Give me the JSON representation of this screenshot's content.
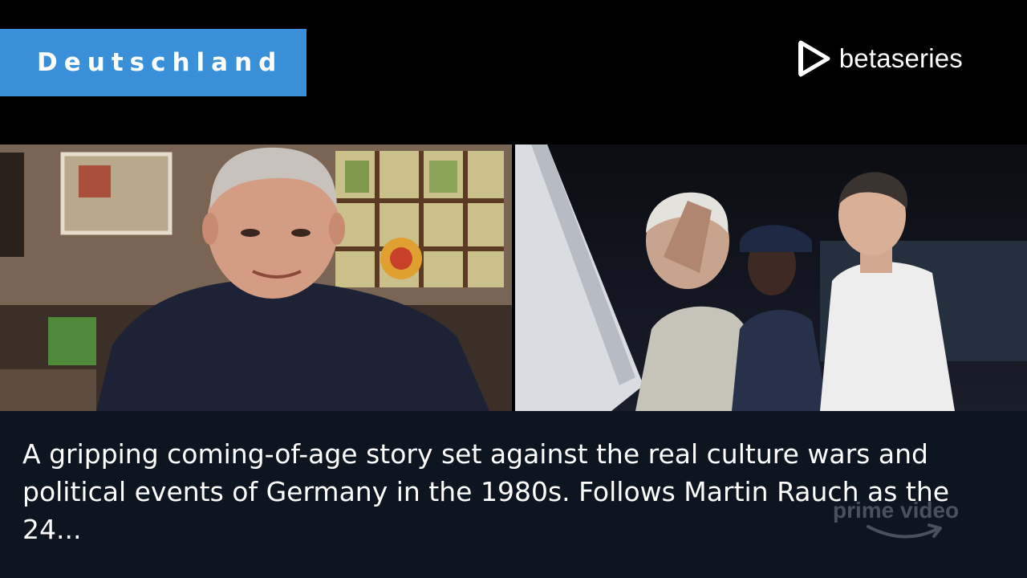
{
  "header": {
    "country_label": "Deutschland"
  },
  "brand": {
    "name": "betaseries",
    "icon": "play-triangle-icon"
  },
  "video": {
    "left_frame": "interview-frame",
    "right_frame": "archive-footage-frame"
  },
  "caption": {
    "text": "A gripping coming-of-age story set against the real culture wars and political events of Germany in the 1980s. Follows Martin Rauch as the 24..."
  },
  "watermark": {
    "text": "prime video",
    "icon": "smile-arrow-icon"
  },
  "colors": {
    "badge_background": "#3a8fd9",
    "caption_background": "#0d1620",
    "page_background": "#000000"
  }
}
